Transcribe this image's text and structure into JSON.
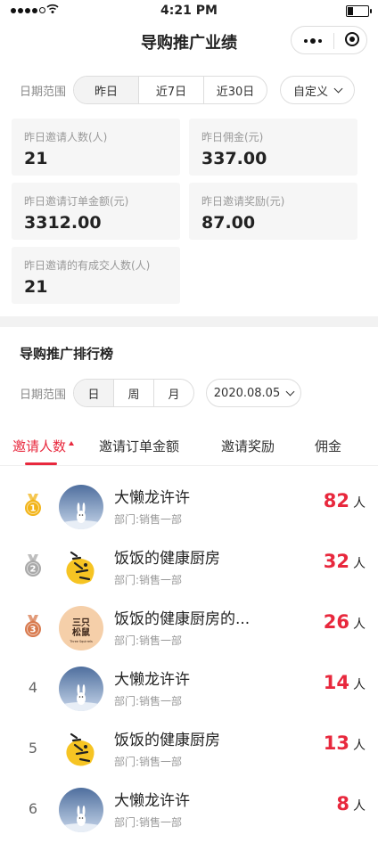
{
  "status": {
    "time": "4:21 PM"
  },
  "nav": {
    "title": "导购推广业绩"
  },
  "summary": {
    "range_label": "日期范围",
    "ranges": [
      "昨日",
      "近7日",
      "近30日"
    ],
    "custom_label": "自定义",
    "cards": [
      {
        "label": "昨日邀请人数(人)",
        "value": "21"
      },
      {
        "label": "昨日佣金(元)",
        "value": "337.00"
      },
      {
        "label": "昨日邀请订单金额(元)",
        "value": "3312.00"
      },
      {
        "label": "昨日邀请奖励(元)",
        "value": "87.00"
      },
      {
        "label": "昨日邀请的有成交人数(人)",
        "value": "21"
      }
    ]
  },
  "ranking": {
    "title": "导购推广排行榜",
    "range_label": "日期范围",
    "ranges": [
      "日",
      "周",
      "月"
    ],
    "date": "2020.08.05",
    "tabs": [
      "邀请人数",
      "邀请订单金额",
      "邀请奖励",
      "佣金"
    ],
    "items": [
      {
        "rank": "1",
        "name": "大懒龙许许",
        "dept": "部门:销售一部",
        "count": "82",
        "unit": "人",
        "avatar": "rabbit"
      },
      {
        "rank": "2",
        "name": "饭饭的健康厨房",
        "dept": "部门:销售一部",
        "count": "32",
        "unit": "人",
        "avatar": "food"
      },
      {
        "rank": "3",
        "name": "饭饭的健康厨房的...",
        "dept": "部门:销售一部",
        "count": "26",
        "unit": "人",
        "avatar": "squirrel",
        "avatar_text": "三只松鼠",
        "avatar_sub": "Three Squirrels"
      },
      {
        "rank": "4",
        "name": "大懒龙许许",
        "dept": "部门:销售一部",
        "count": "14",
        "unit": "人",
        "avatar": "rabbit"
      },
      {
        "rank": "5",
        "name": "饭饭的健康厨房",
        "dept": "部门:销售一部",
        "count": "13",
        "unit": "人",
        "avatar": "food"
      },
      {
        "rank": "6",
        "name": "大懒龙许许",
        "dept": "部门:销售一部",
        "count": "8",
        "unit": "人",
        "avatar": "rabbit"
      }
    ]
  },
  "colors": {
    "accent": "#e8283d",
    "gold": "#f2b418",
    "silver": "#a9a9a9",
    "bronze": "#d87a4e"
  }
}
